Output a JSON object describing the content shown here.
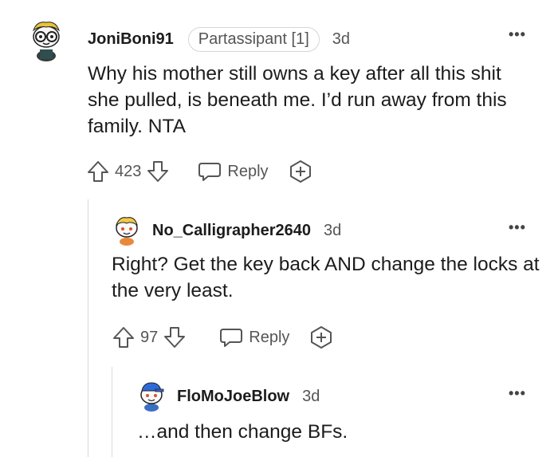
{
  "comments": [
    {
      "username": "JoniBoni91",
      "flair": "Partassipant [1]",
      "time": "3d",
      "more": "•••",
      "body": "Why his mother still owns a key after all this shit she pulled, is beneath me. I’d run away from this family. NTA",
      "votes": "423",
      "reply_label": "Reply",
      "avatar_icon": "avatar-nerd-glasses-icon"
    },
    {
      "username": "No_Calligrapher2640",
      "time": "3d",
      "more": "•••",
      "body": "Right? Get the key back AND change the locks at the very least.",
      "votes": "97",
      "reply_label": "Reply",
      "avatar_icon": "avatar-snoo-blonde-icon"
    },
    {
      "username": "FloMoJoeBlow",
      "time": "3d",
      "more": "•••",
      "body": "…and then change BFs.",
      "avatar_icon": "avatar-snoo-blue-cap-icon"
    }
  ],
  "colors": {
    "text": "#1c1c1c",
    "muted": "#555555",
    "thread_line": "#d9d9d9",
    "flair_border": "#d6d6d6"
  }
}
